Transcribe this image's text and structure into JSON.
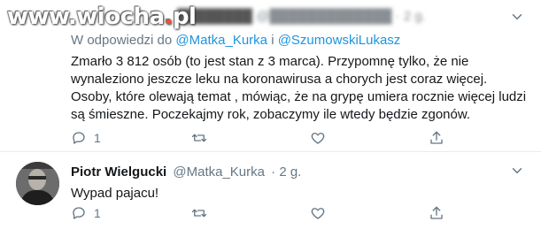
{
  "watermark": {
    "pre": "www.",
    "main": "wiocha",
    "dot": ".",
    "tld": "pl"
  },
  "tweet1": {
    "header_blurred": "· 2 g.",
    "reply_prefix": "W odpowiedzi do",
    "mention1": "@Matka_Kurka",
    "conjunction": "i",
    "mention2": "@SzumowskiLukasz",
    "text": "Zmarło 3 812 osób (to jest stan z 3 marca). Przypomnę tylko, że nie wynaleziono jeszcze leku na koronawirusa a chorych jest coraz więcej. Osoby, które olewają temat , mówiąc, że na grypę umiera rocznie więcej ludzi są śmieszne. Poczekajmy rok, zobaczymy ile wtedy będzie zgonów.",
    "reply_count": "1",
    "actions": [
      "reply-icon",
      "retweet-icon",
      "like-icon",
      "share-icon"
    ]
  },
  "tweet2": {
    "name": "Piotr Wielgucki",
    "handle": "@Matka_Kurka",
    "time": "· 2 g.",
    "text": "Wypad pajacu!",
    "reply_count": "1",
    "actions": [
      "reply-icon",
      "retweet-icon",
      "like-icon",
      "share-icon"
    ]
  },
  "colors": {
    "link": "#1b95e0",
    "muted": "#657786",
    "text": "#14171a",
    "icon": "#657786"
  }
}
